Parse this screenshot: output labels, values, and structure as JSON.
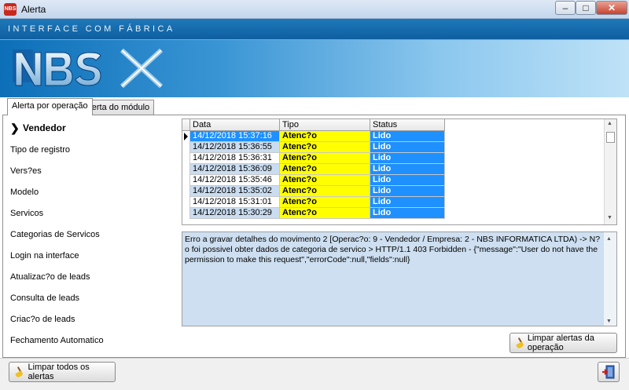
{
  "window": {
    "title": "Alerta",
    "app_icon": "NBS"
  },
  "banner": {
    "caption": "INTERFACE COM FÁBRICA",
    "logo_text": "NBS"
  },
  "tabs": [
    {
      "label": "Alerta por operação",
      "active": true
    },
    {
      "label": "Alerta do módulo",
      "active": false
    }
  ],
  "nav": {
    "items": [
      {
        "label": "Vendedor",
        "active": true
      },
      {
        "label": "Tipo de registro"
      },
      {
        "label": "Vers?es"
      },
      {
        "label": "Modelo"
      },
      {
        "label": "Servicos"
      },
      {
        "label": "Categorias de Servicos"
      },
      {
        "label": "Login na interface"
      },
      {
        "label": "Atualizac?o de leads"
      },
      {
        "label": "Consulta de leads"
      },
      {
        "label": "Criac?o de leads"
      },
      {
        "label": "Fechamento Automatico"
      }
    ]
  },
  "grid": {
    "columns": [
      "Data",
      "Tipo",
      "Status"
    ],
    "rows": [
      {
        "data": "14/12/2018 15:37:16",
        "tipo": "Atenc?o",
        "status": "Lido",
        "selected": true
      },
      {
        "data": "14/12/2018 15:36:55",
        "tipo": "Atenc?o",
        "status": "Lido"
      },
      {
        "data": "14/12/2018 15:36:31",
        "tipo": "Atenc?o",
        "status": "Lido"
      },
      {
        "data": "14/12/2018 15:36:09",
        "tipo": "Atenc?o",
        "status": "Lido"
      },
      {
        "data": "14/12/2018 15:35:46",
        "tipo": "Atenc?o",
        "status": "Lido"
      },
      {
        "data": "14/12/2018 15:35:02",
        "tipo": "Atenc?o",
        "status": "Lido"
      },
      {
        "data": "14/12/2018 15:31:01",
        "tipo": "Atenc?o",
        "status": "Lido"
      },
      {
        "data": "14/12/2018 15:30:29",
        "tipo": "Atenc?o",
        "status": "Lido"
      }
    ]
  },
  "message": "Erro a gravar detalhes do movimento 2 [Operac?o: 9 - Vendedor / Empresa: 2 - NBS INFORMATICA LTDA) -> N?o foi possivel obter dados de categoria de servico > HTTP/1.1 403 Forbidden - {\"message\":\"User do not have the permission to make this request\",\"errorCode\":null,\"fields\":null}",
  "buttons": {
    "clear_operation": "Limpar alertas da operação",
    "clear_all": "Limpar todos os alertas",
    "exit_icon": "exit-door-icon"
  },
  "colors": {
    "tipo_bg": "#ffff00",
    "status_bg": "#1e90ff",
    "selected_bg": "#1e90ff",
    "alt_row": "#c9dcf0"
  }
}
